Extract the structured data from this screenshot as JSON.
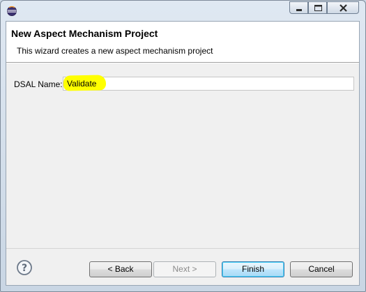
{
  "window": {
    "title": "",
    "icon": "eclipse-icon",
    "controls": {
      "minimize": "minimize-icon",
      "maximize": "maximize-icon",
      "close": "close-icon"
    }
  },
  "header": {
    "title": "New Aspect Mechanism Project",
    "description": "This wizard creates a new aspect mechanism project"
  },
  "form": {
    "dsal_name_label": "DSAL Name:",
    "dsal_name_value": "Validate",
    "highlight_color": "#ffff00"
  },
  "footer": {
    "help_icon": "help-icon",
    "back_label": "< Back",
    "next_label": "Next >",
    "finish_label": "Finish",
    "cancel_label": "Cancel"
  }
}
